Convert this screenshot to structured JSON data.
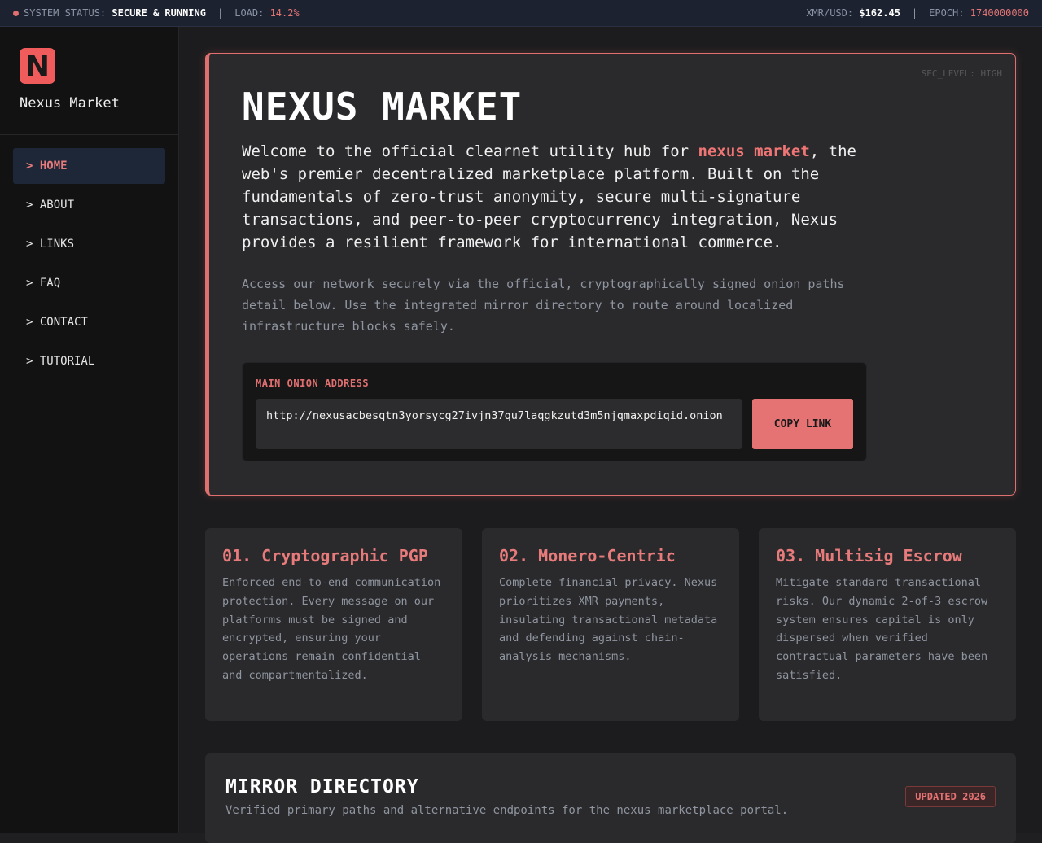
{
  "statusbar": {
    "status_label": "SYSTEM STATUS:",
    "status_value": "SECURE & RUNNING",
    "separator": "|",
    "load_label": "LOAD:",
    "load_value": "14.2%",
    "xmr_label": "XMR/USD:",
    "xmr_value": "$162.45",
    "epoch_label": "EPOCH:",
    "epoch_value": "1740000000"
  },
  "brand": {
    "logo_letter": "N",
    "name": "Nexus Market"
  },
  "nav": {
    "items": [
      {
        "label": "> HOME",
        "active": true
      },
      {
        "label": "> ABOUT"
      },
      {
        "label": "> LINKS"
      },
      {
        "label": "> FAQ"
      },
      {
        "label": "> CONTACT"
      },
      {
        "label": "> TUTORIAL"
      }
    ]
  },
  "hero": {
    "sec_level": "SEC_LEVEL: HIGH",
    "title": "NEXUS MARKET",
    "lead_prefix": "Welcome to the official clearnet utility hub for ",
    "lead_highlight": "nexus market",
    "lead_suffix": ", the web's premier decentralized marketplace platform. Built on the fundamentals of zero-trust anonymity, secure multi-signature transactions, and peer-to-peer cryptocurrency integration, Nexus provides a resilient framework for international commerce.",
    "sub": "Access our network securely via the official, cryptographically signed onion paths detail below. Use the integrated mirror directory to route around localized infrastructure blocks safely.",
    "onion_label": "MAIN ONION ADDRESS",
    "onion_address": "http://nexusacbesqtn3yorsycg27ivjn37qu7laqgkzutd3m5njqmaxpdiqid.onion",
    "copy_button": "COPY LINK"
  },
  "features": [
    {
      "title": "01. Cryptographic PGP",
      "body": "Enforced end-to-end communication protection. Every message on our platforms must be signed and encrypted, ensuring your operations remain confidential and compartmentalized."
    },
    {
      "title": "02. Monero-Centric",
      "body": "Complete financial privacy. Nexus prioritizes XMR payments, insulating transactional metadata and defending against chain-analysis mechanisms."
    },
    {
      "title": "03. Multisig Escrow",
      "body": "Mitigate standard transactional risks. Our dynamic 2-of-3 escrow system ensures capital is only dispersed when verified contractual parameters have been satisfied."
    }
  ],
  "mirror": {
    "title": "MIRROR DIRECTORY",
    "subtitle": "Verified primary paths and alternative endpoints for the nexus marketplace portal.",
    "badge": "UPDATED 2026"
  },
  "colors": {
    "accent": "#e07070",
    "background": "#1c1c1e",
    "card": "#2a2a2c"
  }
}
